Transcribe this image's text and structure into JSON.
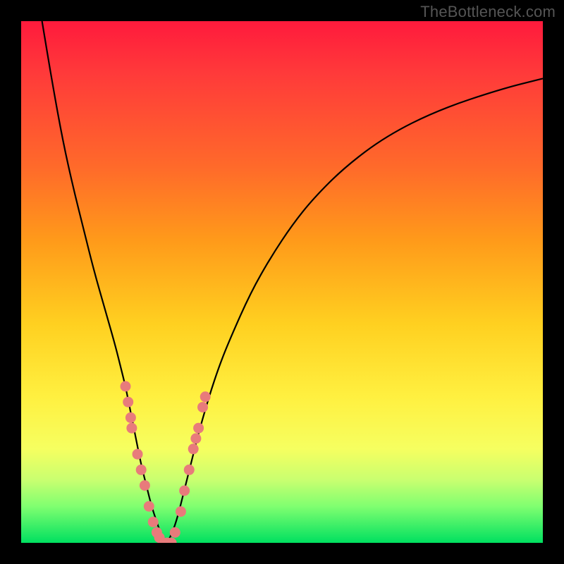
{
  "watermark": "TheBottleneck.com",
  "colors": {
    "frame": "#000000",
    "curve": "#000000",
    "dot": "#e87b7b",
    "gradient_stops": [
      "#ff1a3c",
      "#ff3a3a",
      "#ff6a2a",
      "#ff9a1a",
      "#ffd020",
      "#fff040",
      "#f6ff60",
      "#c8ff70",
      "#80ff70",
      "#00e060"
    ]
  },
  "chart_data": {
    "type": "line",
    "title": "",
    "xlabel": "",
    "ylabel": "",
    "xlim": [
      0,
      100
    ],
    "ylim": [
      0,
      100
    ],
    "legend": null,
    "grid": false,
    "series": [
      {
        "name": "left-branch",
        "x": [
          4,
          6,
          8,
          10,
          12,
          14,
          16,
          18,
          19,
          20,
          21,
          22,
          23,
          24,
          25,
          26,
          27,
          28
        ],
        "y": [
          100,
          88,
          77,
          68,
          60,
          52,
          45,
          38,
          34,
          30,
          25,
          20,
          15,
          11,
          7,
          4,
          1,
          0
        ]
      },
      {
        "name": "right-branch",
        "x": [
          28,
          29,
          30,
          31,
          32,
          33,
          34,
          36,
          38,
          40,
          44,
          48,
          52,
          56,
          62,
          70,
          80,
          92,
          100
        ],
        "y": [
          0,
          2,
          5,
          9,
          13,
          17,
          21,
          28,
          34,
          39,
          48,
          55,
          61,
          66,
          72,
          78,
          83,
          87,
          89
        ]
      }
    ],
    "scatter_overlay": {
      "name": "highlight-dots",
      "points": [
        {
          "x": 20.0,
          "y": 30
        },
        {
          "x": 20.5,
          "y": 27
        },
        {
          "x": 21.0,
          "y": 24
        },
        {
          "x": 21.2,
          "y": 22
        },
        {
          "x": 22.3,
          "y": 17
        },
        {
          "x": 23.0,
          "y": 14
        },
        {
          "x": 23.7,
          "y": 11
        },
        {
          "x": 24.5,
          "y": 7
        },
        {
          "x": 25.3,
          "y": 4
        },
        {
          "x": 26.0,
          "y": 2
        },
        {
          "x": 26.5,
          "y": 1
        },
        {
          "x": 27.2,
          "y": 0
        },
        {
          "x": 28.0,
          "y": 0
        },
        {
          "x": 28.8,
          "y": 0
        },
        {
          "x": 29.5,
          "y": 2
        },
        {
          "x": 30.6,
          "y": 6
        },
        {
          "x": 31.3,
          "y": 10
        },
        {
          "x": 32.2,
          "y": 14
        },
        {
          "x": 33.0,
          "y": 18
        },
        {
          "x": 33.5,
          "y": 20
        },
        {
          "x": 34.0,
          "y": 22
        },
        {
          "x": 34.8,
          "y": 26
        },
        {
          "x": 35.3,
          "y": 28
        }
      ]
    }
  }
}
